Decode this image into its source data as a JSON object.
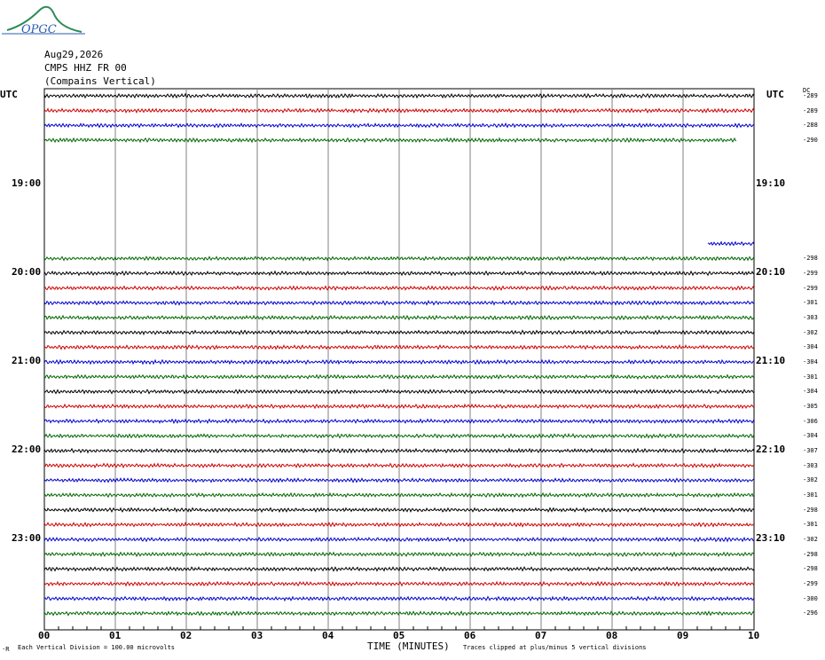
{
  "header": {
    "date": "Aug29,2026",
    "station": "CMPS HHZ FR 00",
    "location": "(Compains Vertical)",
    "logo_text": "OPGC"
  },
  "axis": {
    "left_tz": "UTC",
    "right_tz": "UTC",
    "dc_header": "DC",
    "xlabel": "TIME (MINUTES)",
    "vertical_division_note": "Each Vertical Division =  100.00 microvolts",
    "clip_note": "Traces clipped at plus/minus 5 vertical divisions",
    "corner_mark": "·R"
  },
  "colors": {
    "cycle": [
      "#000000",
      "#cc0000",
      "#0000cc",
      "#006600"
    ],
    "grid": "#808080"
  },
  "chart_data": {
    "type": "line",
    "x_ticks": [
      "00",
      "01",
      "02",
      "03",
      "04",
      "05",
      "06",
      "07",
      "08",
      "09",
      "10"
    ],
    "xlim": [
      0,
      10
    ],
    "left_hour_labels": [
      "19:00",
      "20:00",
      "21:00",
      "22:00",
      "23:00"
    ],
    "right_hour_labels": [
      "19:10",
      "20:10",
      "21:10",
      "22:10",
      "23:10"
    ],
    "traces": [
      {
        "row": 0,
        "color_idx": 0,
        "dc": "-289",
        "start_min": 0,
        "end_min": 10
      },
      {
        "row": 1,
        "color_idx": 1,
        "dc": "-289",
        "start_min": 0,
        "end_min": 10
      },
      {
        "row": 2,
        "color_idx": 2,
        "dc": "-288",
        "start_min": 0,
        "end_min": 10
      },
      {
        "row": 3,
        "color_idx": 3,
        "dc": "-290",
        "start_min": 0,
        "end_min": 9.75
      },
      {
        "row": 10,
        "color_idx": 2,
        "dc": "",
        "start_min": 9.35,
        "end_min": 10
      },
      {
        "row": 11,
        "color_idx": 3,
        "dc": "-298",
        "start_min": 0,
        "end_min": 10
      },
      {
        "row": 12,
        "color_idx": 0,
        "dc": "-299",
        "start_min": 0,
        "end_min": 10
      },
      {
        "row": 13,
        "color_idx": 1,
        "dc": "-299",
        "start_min": 0,
        "end_min": 10
      },
      {
        "row": 14,
        "color_idx": 2,
        "dc": "-301",
        "start_min": 0,
        "end_min": 10
      },
      {
        "row": 15,
        "color_idx": 3,
        "dc": "-303",
        "start_min": 0,
        "end_min": 10
      },
      {
        "row": 16,
        "color_idx": 0,
        "dc": "-302",
        "start_min": 0,
        "end_min": 10
      },
      {
        "row": 17,
        "color_idx": 1,
        "dc": "-304",
        "start_min": 0,
        "end_min": 10
      },
      {
        "row": 18,
        "color_idx": 2,
        "dc": "-304",
        "start_min": 0,
        "end_min": 10
      },
      {
        "row": 19,
        "color_idx": 3,
        "dc": "-301",
        "start_min": 0,
        "end_min": 10
      },
      {
        "row": 20,
        "color_idx": 0,
        "dc": "-304",
        "start_min": 0,
        "end_min": 10
      },
      {
        "row": 21,
        "color_idx": 1,
        "dc": "-305",
        "start_min": 0,
        "end_min": 10
      },
      {
        "row": 22,
        "color_idx": 2,
        "dc": "-306",
        "start_min": 0,
        "end_min": 10
      },
      {
        "row": 23,
        "color_idx": 3,
        "dc": "-304",
        "start_min": 0,
        "end_min": 10
      },
      {
        "row": 24,
        "color_idx": 0,
        "dc": "-307",
        "start_min": 0,
        "end_min": 10
      },
      {
        "row": 25,
        "color_idx": 1,
        "dc": "-303",
        "start_min": 0,
        "end_min": 10
      },
      {
        "row": 26,
        "color_idx": 2,
        "dc": "-302",
        "start_min": 0,
        "end_min": 10
      },
      {
        "row": 27,
        "color_idx": 3,
        "dc": "-301",
        "start_min": 0,
        "end_min": 10
      },
      {
        "row": 28,
        "color_idx": 0,
        "dc": "-298",
        "start_min": 0,
        "end_min": 10
      },
      {
        "row": 29,
        "color_idx": 1,
        "dc": "-301",
        "start_min": 0,
        "end_min": 10
      },
      {
        "row": 30,
        "color_idx": 2,
        "dc": "-302",
        "start_min": 0,
        "end_min": 10
      },
      {
        "row": 31,
        "color_idx": 3,
        "dc": "-298",
        "start_min": 0,
        "end_min": 10
      },
      {
        "row": 32,
        "color_idx": 0,
        "dc": "-298",
        "start_min": 0,
        "end_min": 10
      },
      {
        "row": 33,
        "color_idx": 1,
        "dc": "-299",
        "start_min": 0,
        "end_min": 10
      },
      {
        "row": 34,
        "color_idx": 2,
        "dc": "-300",
        "start_min": 0,
        "end_min": 10
      },
      {
        "row": 35,
        "color_idx": 3,
        "dc": "-296",
        "start_min": 0,
        "end_min": 10
      }
    ]
  }
}
